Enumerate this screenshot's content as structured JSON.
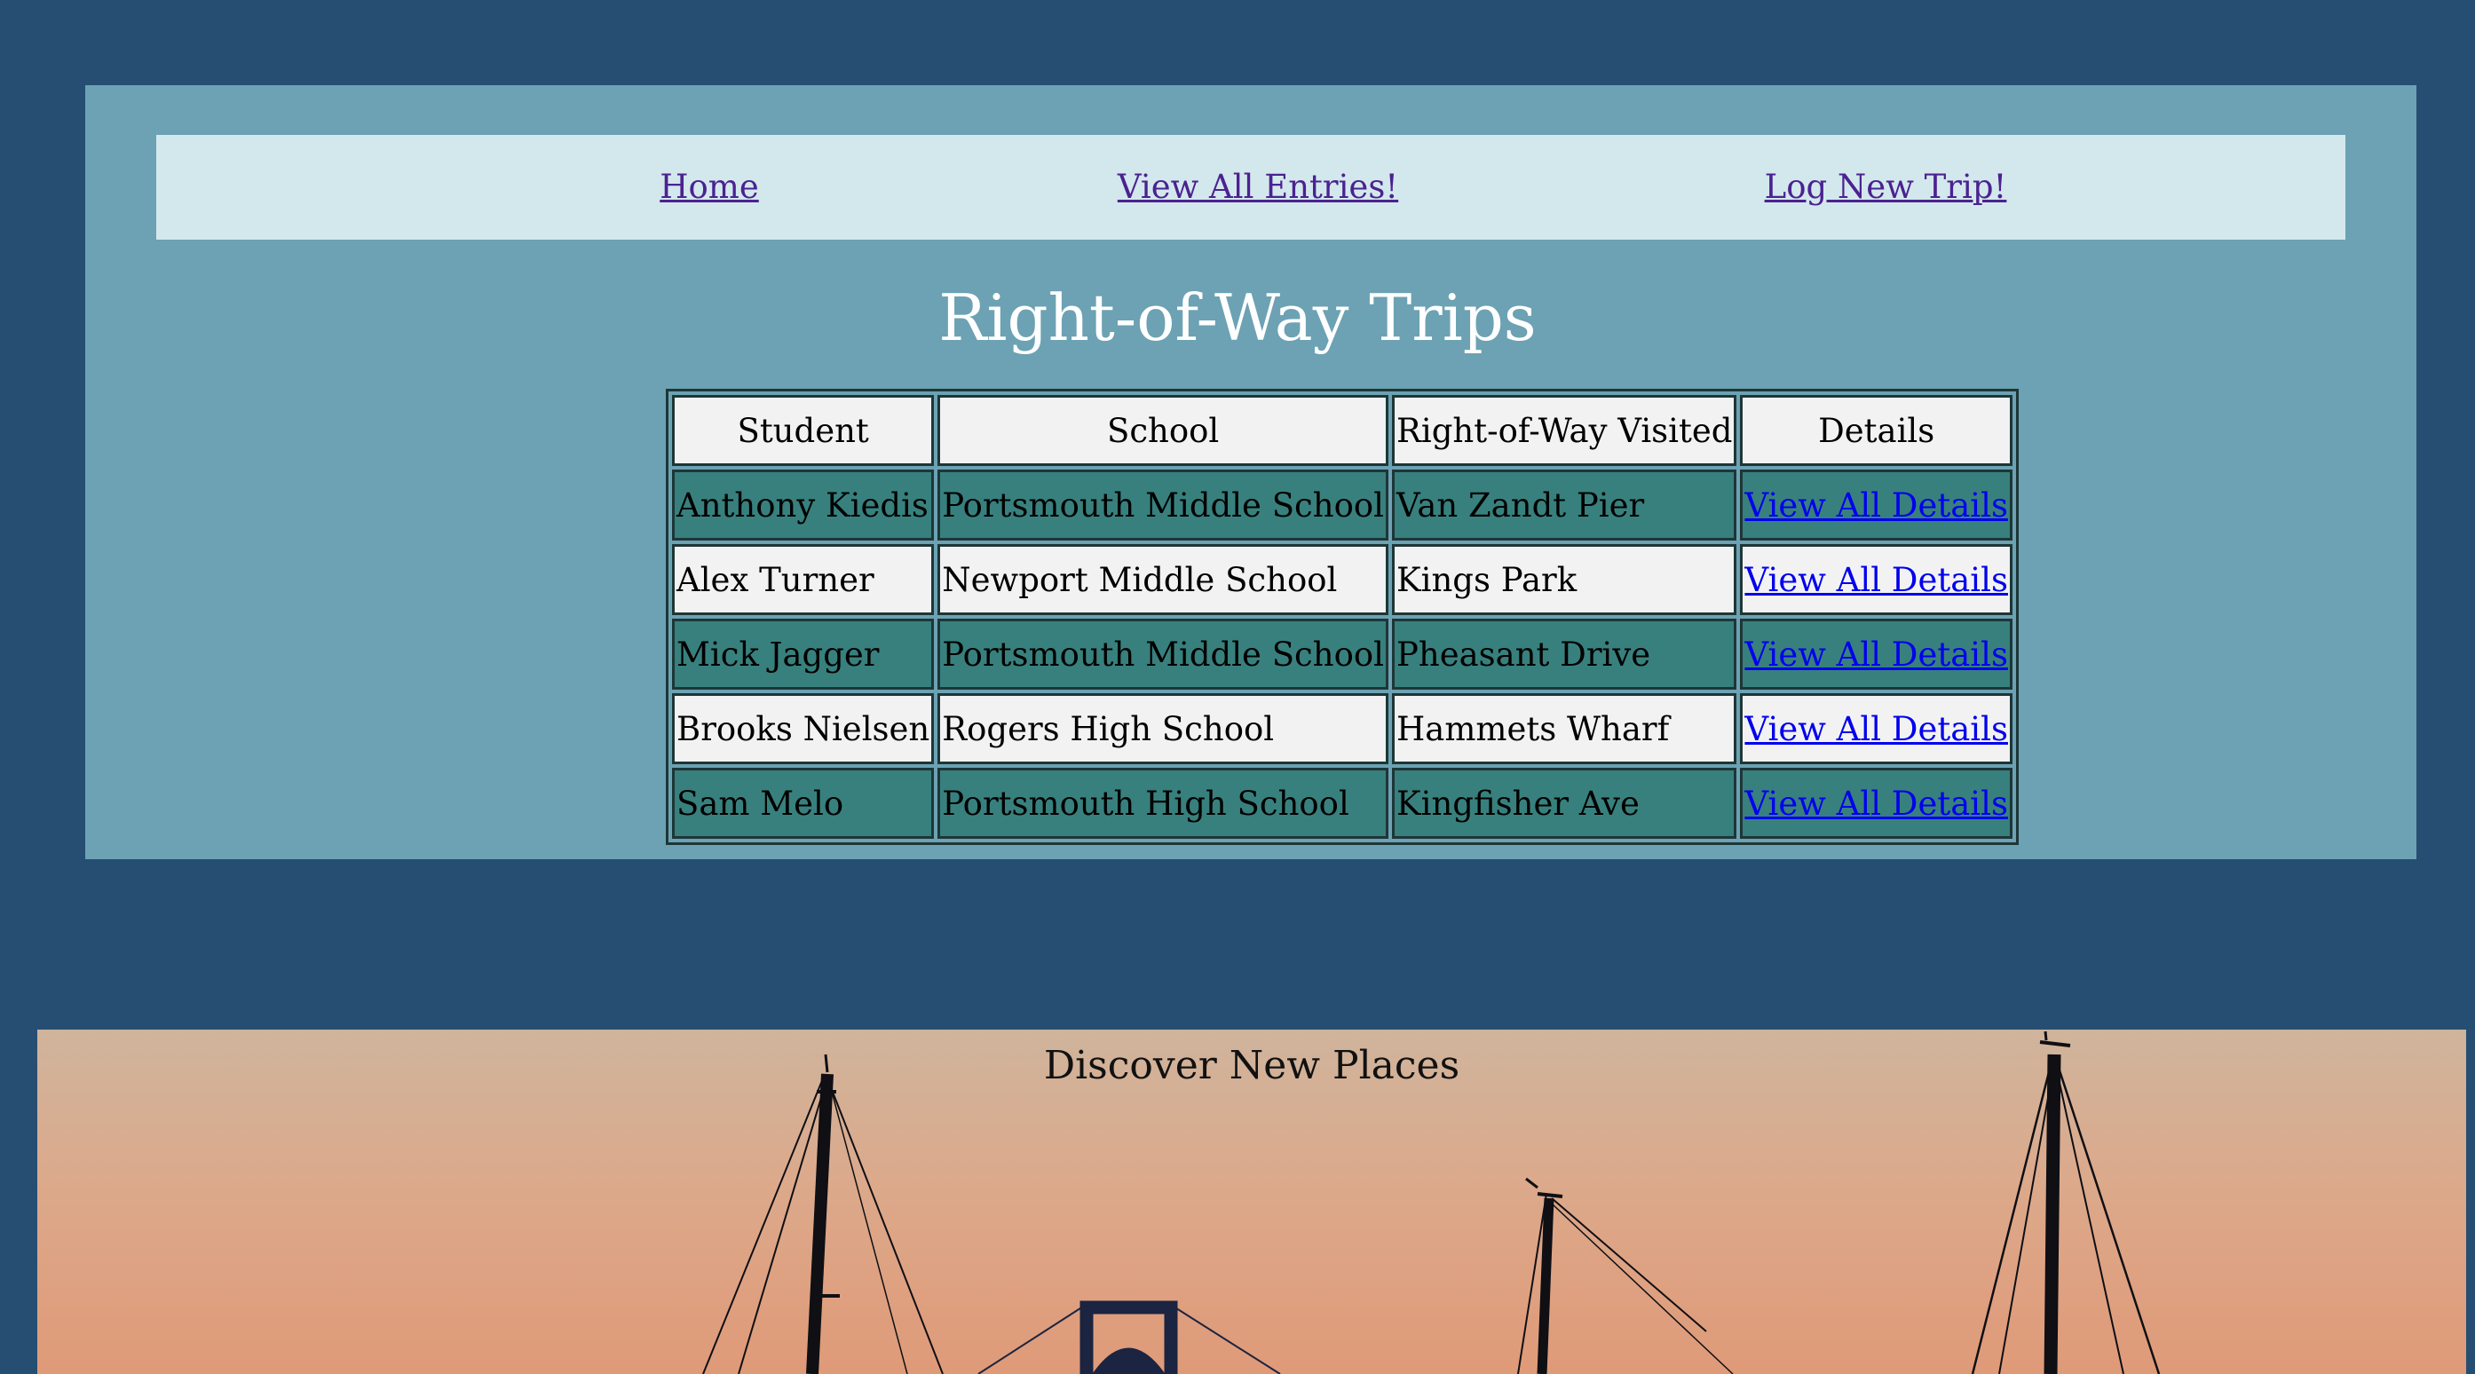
{
  "nav": {
    "home": "Home",
    "view_all": "View All Entries!",
    "log_new": "Log New Trip!"
  },
  "page_title": "Right-of-Way Trips",
  "table": {
    "headers": [
      "Student",
      "School",
      "Right-of-Way Visited",
      "Details"
    ],
    "rows": [
      {
        "student": "Anthony Kiedis",
        "school": "Portsmouth Middle School",
        "row": "Van Zandt Pier",
        "details": "View All Details"
      },
      {
        "student": "Alex Turner",
        "school": "Newport Middle School",
        "row": "Kings Park",
        "details": "View All Details"
      },
      {
        "student": "Mick Jagger",
        "school": "Portsmouth Middle School",
        "row": "Pheasant Drive",
        "details": "View All Details"
      },
      {
        "student": "Brooks Nielsen",
        "school": "Rogers High School",
        "row": "Hammets Wharf",
        "details": "View All Details"
      },
      {
        "student": "Sam Melo",
        "school": "Portsmouth High School",
        "row": "Kingfisher Ave",
        "details": "View All Details"
      }
    ]
  },
  "hero": {
    "title": "Discover New Places"
  },
  "colors": {
    "page_background": "#264e73",
    "panel_background": "#6ca2b3",
    "nav_background": "#d3e8ed",
    "nav_link": "#4b2290",
    "row_teal": "#38807d",
    "row_light": "#f2f2f2",
    "details_link": "#0000ee"
  }
}
